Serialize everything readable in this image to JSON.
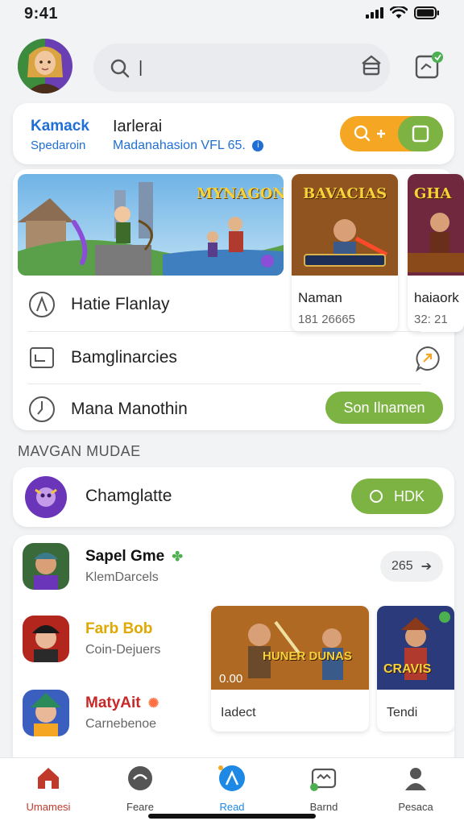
{
  "status": {
    "time": "9:41"
  },
  "search": {
    "value": "|",
    "placeholder": ""
  },
  "quickbar": {
    "brand": "Kamack",
    "brand_sub": "Spedaroin",
    "title": "Iarlerai",
    "description": "Madanahasion VFL 65."
  },
  "feature": {
    "banner_title": "MYNAGON",
    "side_cards": [
      {
        "title": "BAVACIAS",
        "label": "Naman",
        "value": "181 26665"
      },
      {
        "title": "GHA",
        "label": "haiaork",
        "value": "32: 21"
      }
    ],
    "rows": [
      {
        "label": "Hatie Flanlay"
      },
      {
        "label": "Bamglinarcies"
      },
      {
        "label": "Mana Manothin",
        "button": "Son Ilnamen"
      }
    ]
  },
  "section": {
    "title": "MAVGAN MUDAE"
  },
  "challenge": {
    "label": "Chamglatte",
    "button": "HDK"
  },
  "games": [
    {
      "name": "Sapel Gme",
      "sub": "KlemDarcels",
      "color": "#111111",
      "badge_color": "#4caf50"
    },
    {
      "name": "Farb Bob",
      "sub": "Coin-Dejuers",
      "color": "#e0a800",
      "badge_color": "#4caf50"
    },
    {
      "name": "MatyAit",
      "sub": "Carnebenoe",
      "color": "#c62828",
      "badge_color": "#ff7043"
    }
  ],
  "more": {
    "label": "265"
  },
  "promos": [
    {
      "title": "HUNER DUNAS",
      "tag": "0.00",
      "label": "Iadect"
    },
    {
      "title": "CRAVIS",
      "label": "Tendi"
    }
  ],
  "tabs": [
    {
      "label": "Umamesi",
      "active": false
    },
    {
      "label": "Feare",
      "active": false
    },
    {
      "label": "Read",
      "active": true
    },
    {
      "label": "Barnd",
      "active": false
    },
    {
      "label": "Pesaca",
      "active": false
    }
  ],
  "colors": {
    "accent_green": "#7cb342",
    "accent_orange": "#f5a623",
    "accent_blue": "#1f6fd6",
    "tab_active": "#1e88e5",
    "home_tab": "#c0392b"
  }
}
